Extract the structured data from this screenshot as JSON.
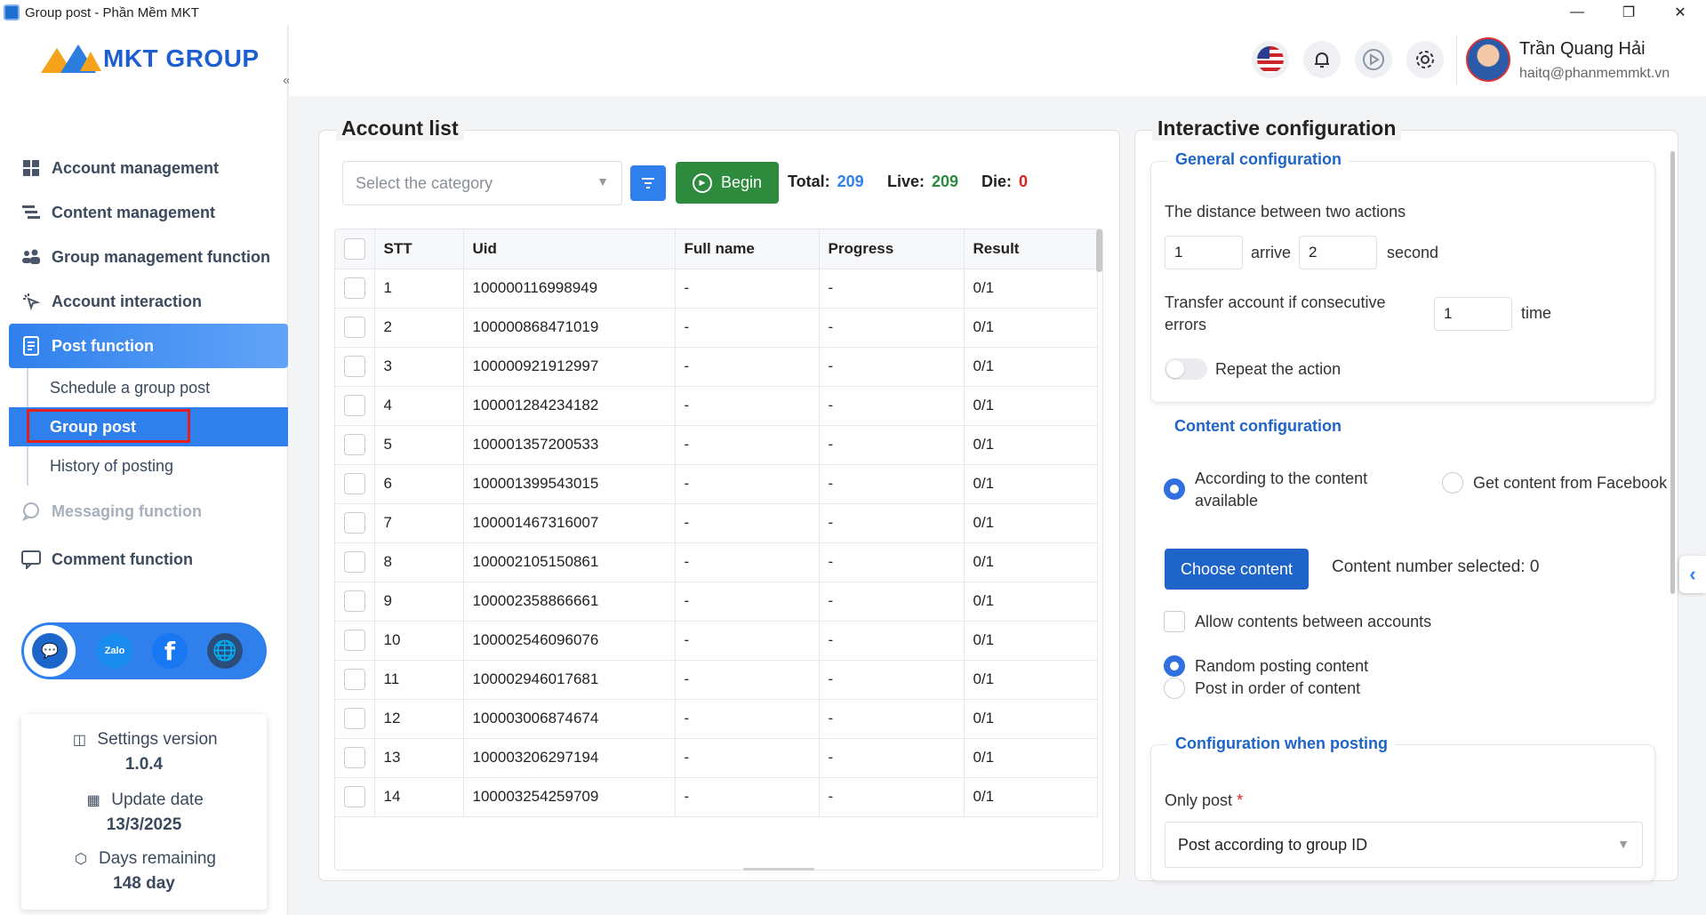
{
  "window": {
    "title": "Group post - Phần Mềm MKT",
    "minimize": "—",
    "restore": "❐",
    "close": "✕"
  },
  "brand": {
    "name": "MKT GROUP",
    "collapse": "«"
  },
  "nav": {
    "account_management": "Account management",
    "content_management": "Content management",
    "group_management": "Group management function",
    "account_interaction": "Account interaction",
    "post_function": "Post function",
    "sub": [
      "Schedule a group post",
      "Group post",
      "History of posting"
    ],
    "messaging": "Messaging function",
    "comment": "Comment function"
  },
  "social": {
    "zalo": "Zalo",
    "facebook": "f",
    "web": "🌐",
    "support": "💬"
  },
  "version_card": {
    "settings_label": "Settings version",
    "settings_value": "1.0.4",
    "update_label": "Update date",
    "update_value": "13/3/2025",
    "days_label": "Days remaining",
    "days_value": "148 day"
  },
  "header": {
    "user_name": "Trần Quang Hải",
    "user_email": "haitq@phanmemmkt.vn"
  },
  "account_list": {
    "title": "Account list",
    "category_placeholder": "Select the category",
    "begin_label": "Begin",
    "total_label": "Total:",
    "total_value": "209",
    "live_label": "Live:",
    "live_value": "209",
    "die_label": "Die:",
    "die_value": "0",
    "columns": [
      "STT",
      "Uid",
      "Full name",
      "Progress",
      "Result"
    ],
    "rows": [
      [
        "1",
        "100000116998949",
        "-",
        "-",
        "0/1"
      ],
      [
        "2",
        "100000868471019",
        "-",
        "-",
        "0/1"
      ],
      [
        "3",
        "100000921912997",
        "-",
        "-",
        "0/1"
      ],
      [
        "4",
        "100001284234182",
        "-",
        "-",
        "0/1"
      ],
      [
        "5",
        "100001357200533",
        "-",
        "-",
        "0/1"
      ],
      [
        "6",
        "100001399543015",
        "-",
        "-",
        "0/1"
      ],
      [
        "7",
        "100001467316007",
        "-",
        "-",
        "0/1"
      ],
      [
        "8",
        "100002105150861",
        "-",
        "-",
        "0/1"
      ],
      [
        "9",
        "100002358866661",
        "-",
        "-",
        "0/1"
      ],
      [
        "10",
        "100002546096076",
        "-",
        "-",
        "0/1"
      ],
      [
        "11",
        "100002946017681",
        "-",
        "-",
        "0/1"
      ],
      [
        "12",
        "100003006874674",
        "-",
        "-",
        "0/1"
      ],
      [
        "13",
        "100003206297194",
        "-",
        "-",
        "0/1"
      ],
      [
        "14",
        "100003254259709",
        "-",
        "-",
        "0/1"
      ]
    ]
  },
  "config": {
    "title": "Interactive configuration",
    "general": {
      "title": "General configuration",
      "distance_label": "The distance between two actions",
      "from_value": "1",
      "arrive_label": "arrive",
      "to_value": "2",
      "second_label": "second",
      "transfer_label": "Transfer account if consecutive errors",
      "transfer_value": "1",
      "time_label": "time",
      "repeat_label": "Repeat the action"
    },
    "content": {
      "title": "Content configuration",
      "option_available": "According to the content available",
      "option_facebook": "Get content from Facebook",
      "choose_btn": "Choose content",
      "selected_label": "Content number selected: 0",
      "allow_between": "Allow contents between accounts",
      "random_label": "Random posting content",
      "order_label": "Post in order of content"
    },
    "posting": {
      "title": "Configuration when posting",
      "only_post_label": "Only post",
      "required_mark": "*",
      "only_post_value": "Post according to group ID"
    }
  },
  "colors": {
    "accent": "#2f80ed",
    "begin": "#2e8b3e",
    "total": "#2f80ed",
    "live": "#2e8b3e",
    "die": "#e0201e"
  }
}
